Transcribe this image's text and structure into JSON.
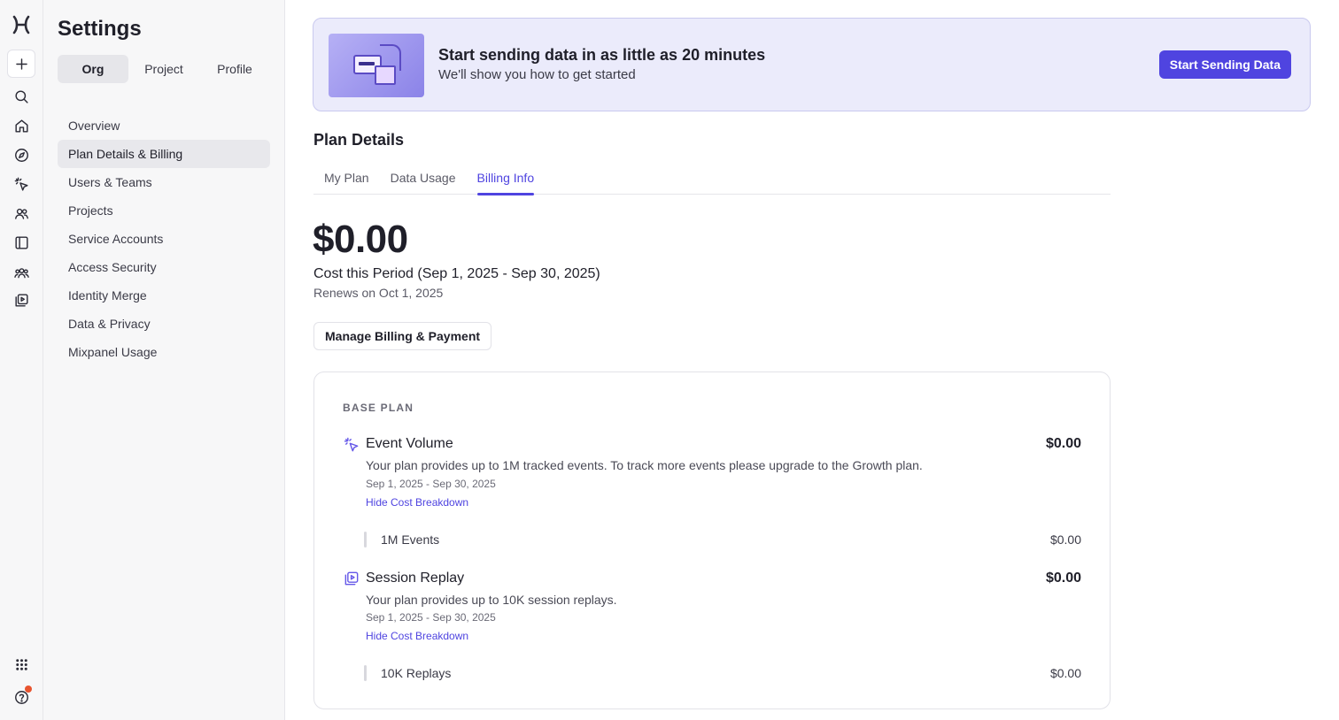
{
  "rail": {
    "icons": [
      "mixpanel-logo-icon",
      "plus-icon",
      "search-icon",
      "home-icon",
      "compass-icon",
      "sparkle-cursor-icon",
      "users-icon",
      "sidebar-panel-icon",
      "teams-icon",
      "session-replay-icon",
      "apps-grid-icon",
      "help-icon"
    ]
  },
  "settings": {
    "title": "Settings",
    "scopes": [
      "Org",
      "Project",
      "Profile"
    ],
    "active_scope": "Org",
    "nav": [
      {
        "label": "Overview"
      },
      {
        "label": "Plan Details & Billing"
      },
      {
        "label": "Users & Teams"
      },
      {
        "label": "Projects"
      },
      {
        "label": "Service Accounts"
      },
      {
        "label": "Access Security"
      },
      {
        "label": "Identity Merge"
      },
      {
        "label": "Data & Privacy"
      },
      {
        "label": "Mixpanel Usage"
      }
    ],
    "active_nav": "Plan Details & Billing"
  },
  "banner": {
    "title": "Start sending data in as little as 20 minutes",
    "subtitle": "We'll show you how to get started",
    "button": "Start Sending Data"
  },
  "plan": {
    "section_title": "Plan Details",
    "tabs": [
      "My Plan",
      "Data Usage",
      "Billing Info"
    ],
    "active_tab": "Billing Info",
    "amount": "$0.00",
    "period": "Cost this Period (Sep 1, 2025 - Sep 30, 2025)",
    "renews": "Renews on Oct 1, 2025",
    "manage_button": "Manage Billing & Payment"
  },
  "base_plan": {
    "label": "BASE PLAN",
    "items": [
      {
        "icon": "sparkle-cursor-icon",
        "name": "Event Volume",
        "price": "$0.00",
        "description": "Your plan provides up to 1M tracked events. To track more events please upgrade to the Growth plan.",
        "dates": "Sep 1, 2025 - Sep 30, 2025",
        "link": "Hide Cost Breakdown",
        "breakdown": {
          "name": "1M Events",
          "price": "$0.00"
        }
      },
      {
        "icon": "session-replay-icon",
        "name": "Session Replay",
        "price": "$0.00",
        "description": "Your plan provides up to 10K session replays.",
        "dates": "Sep 1, 2025 - Sep 30, 2025",
        "link": "Hide Cost Breakdown",
        "breakdown": {
          "name": "10K Replays",
          "price": "$0.00"
        }
      }
    ]
  },
  "colors": {
    "accent": "#4f44e0",
    "banner_bg": "#ebebfb",
    "notification": "#e8542f"
  }
}
